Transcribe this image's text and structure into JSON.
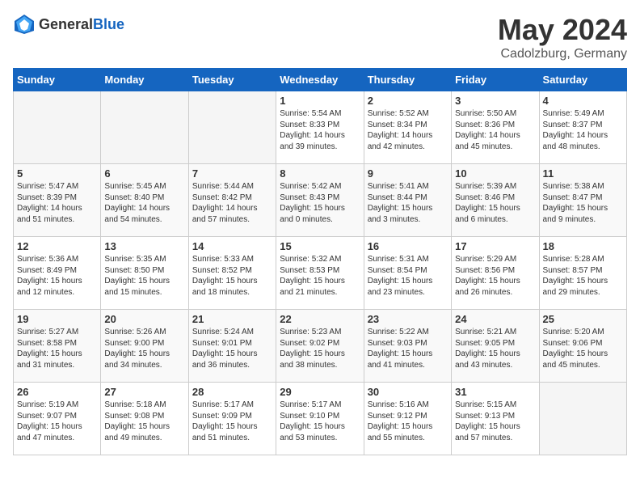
{
  "header": {
    "logo_general": "General",
    "logo_blue": "Blue",
    "month": "May 2024",
    "location": "Cadolzburg, Germany"
  },
  "weekdays": [
    "Sunday",
    "Monday",
    "Tuesday",
    "Wednesday",
    "Thursday",
    "Friday",
    "Saturday"
  ],
  "weeks": [
    [
      {
        "day": "",
        "sunrise": "",
        "sunset": "",
        "daylight": ""
      },
      {
        "day": "",
        "sunrise": "",
        "sunset": "",
        "daylight": ""
      },
      {
        "day": "",
        "sunrise": "",
        "sunset": "",
        "daylight": ""
      },
      {
        "day": "1",
        "sunrise": "Sunrise: 5:54 AM",
        "sunset": "Sunset: 8:33 PM",
        "daylight": "Daylight: 14 hours and 39 minutes."
      },
      {
        "day": "2",
        "sunrise": "Sunrise: 5:52 AM",
        "sunset": "Sunset: 8:34 PM",
        "daylight": "Daylight: 14 hours and 42 minutes."
      },
      {
        "day": "3",
        "sunrise": "Sunrise: 5:50 AM",
        "sunset": "Sunset: 8:36 PM",
        "daylight": "Daylight: 14 hours and 45 minutes."
      },
      {
        "day": "4",
        "sunrise": "Sunrise: 5:49 AM",
        "sunset": "Sunset: 8:37 PM",
        "daylight": "Daylight: 14 hours and 48 minutes."
      }
    ],
    [
      {
        "day": "5",
        "sunrise": "Sunrise: 5:47 AM",
        "sunset": "Sunset: 8:39 PM",
        "daylight": "Daylight: 14 hours and 51 minutes."
      },
      {
        "day": "6",
        "sunrise": "Sunrise: 5:45 AM",
        "sunset": "Sunset: 8:40 PM",
        "daylight": "Daylight: 14 hours and 54 minutes."
      },
      {
        "day": "7",
        "sunrise": "Sunrise: 5:44 AM",
        "sunset": "Sunset: 8:42 PM",
        "daylight": "Daylight: 14 hours and 57 minutes."
      },
      {
        "day": "8",
        "sunrise": "Sunrise: 5:42 AM",
        "sunset": "Sunset: 8:43 PM",
        "daylight": "Daylight: 15 hours and 0 minutes."
      },
      {
        "day": "9",
        "sunrise": "Sunrise: 5:41 AM",
        "sunset": "Sunset: 8:44 PM",
        "daylight": "Daylight: 15 hours and 3 minutes."
      },
      {
        "day": "10",
        "sunrise": "Sunrise: 5:39 AM",
        "sunset": "Sunset: 8:46 PM",
        "daylight": "Daylight: 15 hours and 6 minutes."
      },
      {
        "day": "11",
        "sunrise": "Sunrise: 5:38 AM",
        "sunset": "Sunset: 8:47 PM",
        "daylight": "Daylight: 15 hours and 9 minutes."
      }
    ],
    [
      {
        "day": "12",
        "sunrise": "Sunrise: 5:36 AM",
        "sunset": "Sunset: 8:49 PM",
        "daylight": "Daylight: 15 hours and 12 minutes."
      },
      {
        "day": "13",
        "sunrise": "Sunrise: 5:35 AM",
        "sunset": "Sunset: 8:50 PM",
        "daylight": "Daylight: 15 hours and 15 minutes."
      },
      {
        "day": "14",
        "sunrise": "Sunrise: 5:33 AM",
        "sunset": "Sunset: 8:52 PM",
        "daylight": "Daylight: 15 hours and 18 minutes."
      },
      {
        "day": "15",
        "sunrise": "Sunrise: 5:32 AM",
        "sunset": "Sunset: 8:53 PM",
        "daylight": "Daylight: 15 hours and 21 minutes."
      },
      {
        "day": "16",
        "sunrise": "Sunrise: 5:31 AM",
        "sunset": "Sunset: 8:54 PM",
        "daylight": "Daylight: 15 hours and 23 minutes."
      },
      {
        "day": "17",
        "sunrise": "Sunrise: 5:29 AM",
        "sunset": "Sunset: 8:56 PM",
        "daylight": "Daylight: 15 hours and 26 minutes."
      },
      {
        "day": "18",
        "sunrise": "Sunrise: 5:28 AM",
        "sunset": "Sunset: 8:57 PM",
        "daylight": "Daylight: 15 hours and 29 minutes."
      }
    ],
    [
      {
        "day": "19",
        "sunrise": "Sunrise: 5:27 AM",
        "sunset": "Sunset: 8:58 PM",
        "daylight": "Daylight: 15 hours and 31 minutes."
      },
      {
        "day": "20",
        "sunrise": "Sunrise: 5:26 AM",
        "sunset": "Sunset: 9:00 PM",
        "daylight": "Daylight: 15 hours and 34 minutes."
      },
      {
        "day": "21",
        "sunrise": "Sunrise: 5:24 AM",
        "sunset": "Sunset: 9:01 PM",
        "daylight": "Daylight: 15 hours and 36 minutes."
      },
      {
        "day": "22",
        "sunrise": "Sunrise: 5:23 AM",
        "sunset": "Sunset: 9:02 PM",
        "daylight": "Daylight: 15 hours and 38 minutes."
      },
      {
        "day": "23",
        "sunrise": "Sunrise: 5:22 AM",
        "sunset": "Sunset: 9:03 PM",
        "daylight": "Daylight: 15 hours and 41 minutes."
      },
      {
        "day": "24",
        "sunrise": "Sunrise: 5:21 AM",
        "sunset": "Sunset: 9:05 PM",
        "daylight": "Daylight: 15 hours and 43 minutes."
      },
      {
        "day": "25",
        "sunrise": "Sunrise: 5:20 AM",
        "sunset": "Sunset: 9:06 PM",
        "daylight": "Daylight: 15 hours and 45 minutes."
      }
    ],
    [
      {
        "day": "26",
        "sunrise": "Sunrise: 5:19 AM",
        "sunset": "Sunset: 9:07 PM",
        "daylight": "Daylight: 15 hours and 47 minutes."
      },
      {
        "day": "27",
        "sunrise": "Sunrise: 5:18 AM",
        "sunset": "Sunset: 9:08 PM",
        "daylight": "Daylight: 15 hours and 49 minutes."
      },
      {
        "day": "28",
        "sunrise": "Sunrise: 5:17 AM",
        "sunset": "Sunset: 9:09 PM",
        "daylight": "Daylight: 15 hours and 51 minutes."
      },
      {
        "day": "29",
        "sunrise": "Sunrise: 5:17 AM",
        "sunset": "Sunset: 9:10 PM",
        "daylight": "Daylight: 15 hours and 53 minutes."
      },
      {
        "day": "30",
        "sunrise": "Sunrise: 5:16 AM",
        "sunset": "Sunset: 9:12 PM",
        "daylight": "Daylight: 15 hours and 55 minutes."
      },
      {
        "day": "31",
        "sunrise": "Sunrise: 5:15 AM",
        "sunset": "Sunset: 9:13 PM",
        "daylight": "Daylight: 15 hours and 57 minutes."
      },
      {
        "day": "",
        "sunrise": "",
        "sunset": "",
        "daylight": ""
      }
    ]
  ]
}
